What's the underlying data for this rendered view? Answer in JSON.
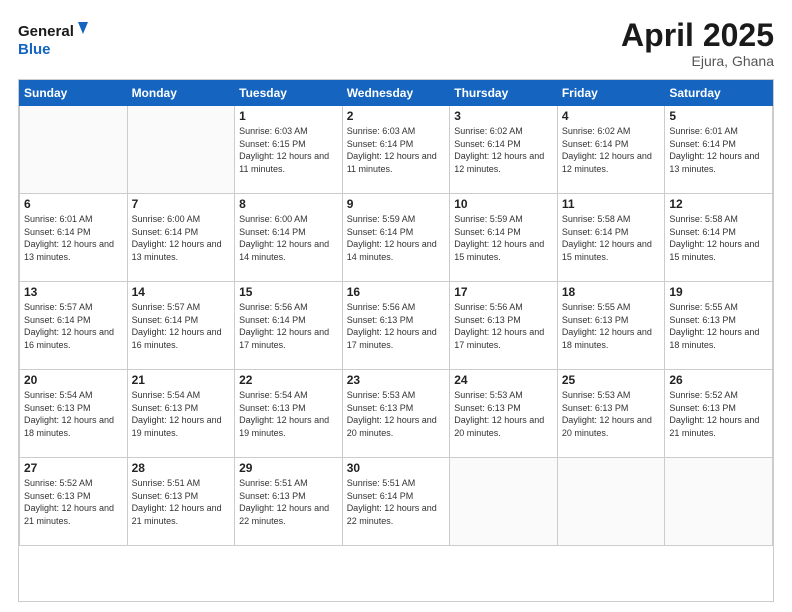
{
  "header": {
    "logo_line1": "General",
    "logo_line2": "Blue",
    "month_year": "April 2025",
    "location": "Ejura, Ghana"
  },
  "days_of_week": [
    "Sunday",
    "Monday",
    "Tuesday",
    "Wednesday",
    "Thursday",
    "Friday",
    "Saturday"
  ],
  "weeks": [
    [
      {
        "day": "",
        "info": ""
      },
      {
        "day": "",
        "info": ""
      },
      {
        "day": "1",
        "info": "Sunrise: 6:03 AM\nSunset: 6:15 PM\nDaylight: 12 hours and 11 minutes."
      },
      {
        "day": "2",
        "info": "Sunrise: 6:03 AM\nSunset: 6:14 PM\nDaylight: 12 hours and 11 minutes."
      },
      {
        "day": "3",
        "info": "Sunrise: 6:02 AM\nSunset: 6:14 PM\nDaylight: 12 hours and 12 minutes."
      },
      {
        "day": "4",
        "info": "Sunrise: 6:02 AM\nSunset: 6:14 PM\nDaylight: 12 hours and 12 minutes."
      },
      {
        "day": "5",
        "info": "Sunrise: 6:01 AM\nSunset: 6:14 PM\nDaylight: 12 hours and 13 minutes."
      }
    ],
    [
      {
        "day": "6",
        "info": "Sunrise: 6:01 AM\nSunset: 6:14 PM\nDaylight: 12 hours and 13 minutes."
      },
      {
        "day": "7",
        "info": "Sunrise: 6:00 AM\nSunset: 6:14 PM\nDaylight: 12 hours and 13 minutes."
      },
      {
        "day": "8",
        "info": "Sunrise: 6:00 AM\nSunset: 6:14 PM\nDaylight: 12 hours and 14 minutes."
      },
      {
        "day": "9",
        "info": "Sunrise: 5:59 AM\nSunset: 6:14 PM\nDaylight: 12 hours and 14 minutes."
      },
      {
        "day": "10",
        "info": "Sunrise: 5:59 AM\nSunset: 6:14 PM\nDaylight: 12 hours and 15 minutes."
      },
      {
        "day": "11",
        "info": "Sunrise: 5:58 AM\nSunset: 6:14 PM\nDaylight: 12 hours and 15 minutes."
      },
      {
        "day": "12",
        "info": "Sunrise: 5:58 AM\nSunset: 6:14 PM\nDaylight: 12 hours and 15 minutes."
      }
    ],
    [
      {
        "day": "13",
        "info": "Sunrise: 5:57 AM\nSunset: 6:14 PM\nDaylight: 12 hours and 16 minutes."
      },
      {
        "day": "14",
        "info": "Sunrise: 5:57 AM\nSunset: 6:14 PM\nDaylight: 12 hours and 16 minutes."
      },
      {
        "day": "15",
        "info": "Sunrise: 5:56 AM\nSunset: 6:14 PM\nDaylight: 12 hours and 17 minutes."
      },
      {
        "day": "16",
        "info": "Sunrise: 5:56 AM\nSunset: 6:13 PM\nDaylight: 12 hours and 17 minutes."
      },
      {
        "day": "17",
        "info": "Sunrise: 5:56 AM\nSunset: 6:13 PM\nDaylight: 12 hours and 17 minutes."
      },
      {
        "day": "18",
        "info": "Sunrise: 5:55 AM\nSunset: 6:13 PM\nDaylight: 12 hours and 18 minutes."
      },
      {
        "day": "19",
        "info": "Sunrise: 5:55 AM\nSunset: 6:13 PM\nDaylight: 12 hours and 18 minutes."
      }
    ],
    [
      {
        "day": "20",
        "info": "Sunrise: 5:54 AM\nSunset: 6:13 PM\nDaylight: 12 hours and 18 minutes."
      },
      {
        "day": "21",
        "info": "Sunrise: 5:54 AM\nSunset: 6:13 PM\nDaylight: 12 hours and 19 minutes."
      },
      {
        "day": "22",
        "info": "Sunrise: 5:54 AM\nSunset: 6:13 PM\nDaylight: 12 hours and 19 minutes."
      },
      {
        "day": "23",
        "info": "Sunrise: 5:53 AM\nSunset: 6:13 PM\nDaylight: 12 hours and 20 minutes."
      },
      {
        "day": "24",
        "info": "Sunrise: 5:53 AM\nSunset: 6:13 PM\nDaylight: 12 hours and 20 minutes."
      },
      {
        "day": "25",
        "info": "Sunrise: 5:53 AM\nSunset: 6:13 PM\nDaylight: 12 hours and 20 minutes."
      },
      {
        "day": "26",
        "info": "Sunrise: 5:52 AM\nSunset: 6:13 PM\nDaylight: 12 hours and 21 minutes."
      }
    ],
    [
      {
        "day": "27",
        "info": "Sunrise: 5:52 AM\nSunset: 6:13 PM\nDaylight: 12 hours and 21 minutes."
      },
      {
        "day": "28",
        "info": "Sunrise: 5:51 AM\nSunset: 6:13 PM\nDaylight: 12 hours and 21 minutes."
      },
      {
        "day": "29",
        "info": "Sunrise: 5:51 AM\nSunset: 6:13 PM\nDaylight: 12 hours and 22 minutes."
      },
      {
        "day": "30",
        "info": "Sunrise: 5:51 AM\nSunset: 6:14 PM\nDaylight: 12 hours and 22 minutes."
      },
      {
        "day": "",
        "info": ""
      },
      {
        "day": "",
        "info": ""
      },
      {
        "day": "",
        "info": ""
      }
    ]
  ]
}
